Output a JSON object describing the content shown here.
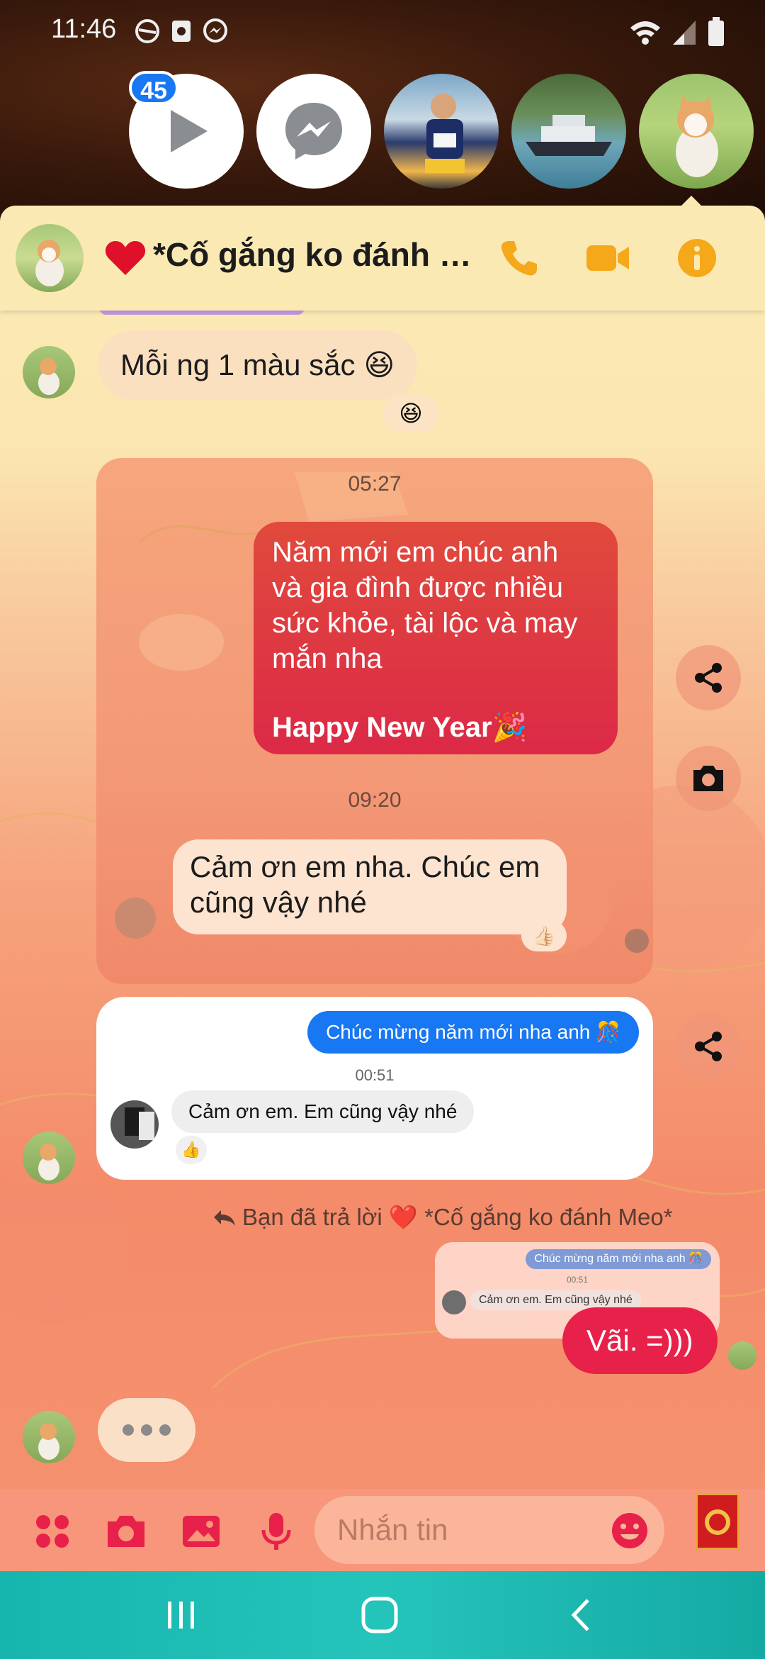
{
  "status_bar": {
    "time": "11:46"
  },
  "chat_heads": {
    "unread_badge": "45"
  },
  "header": {
    "title": "*Cố gắng ko đánh M..."
  },
  "messages": {
    "m1_text": "Mỗi ng 1 màu sắc",
    "m1_emoji": "😆",
    "m1_reaction": "😆",
    "card": {
      "time1": "05:27",
      "greeting_lines": [
        "Năm mới em chúc anh",
        "và gia đình được nhiều",
        "sức khỏe, tài lộc và may",
        "mắn nha"
      ],
      "greeting_footer": "Happy New Year🎉",
      "time2": "09:20",
      "reply_lines": [
        "Cảm ơn em nha. Chúc em",
        "cũng vậy nhé"
      ],
      "reply_reaction": "👍🏻"
    },
    "shared": {
      "sent_text": "Chúc mừng năm mới nha anh 🎊",
      "time": "00:51",
      "reply_text": "Cảm ơn em. Em cũng vậy nhé",
      "reaction": "👍"
    },
    "reply_note": "Bạn đã trả lời ❤️ *Cố gắng ko đánh Meo*",
    "quoted": {
      "sent_text": "Chúc mừng năm mới nha anh 🎊",
      "time": "00:51",
      "reply_text": "Cảm ơn em. Em cũng vậy nhé"
    },
    "last_sent": "Vãi. =)))"
  },
  "composer": {
    "placeholder": "Nhắn tin"
  },
  "colors": {
    "accent": "#e8214a",
    "header_bg": "#fbe9b4",
    "blue_bubble": "#1877f2",
    "greeting_bubble": "#de2f3e"
  },
  "icons": [
    "data-saver-icon",
    "gallery-icon",
    "messenger-icon",
    "wifi-icon",
    "signal-icon",
    "battery-icon",
    "phone-icon",
    "video-icon",
    "info-icon",
    "share-icon",
    "camera-icon",
    "apps-icon",
    "image-icon",
    "mic-icon",
    "emoji-icon",
    "lucky-envelope-icon"
  ]
}
